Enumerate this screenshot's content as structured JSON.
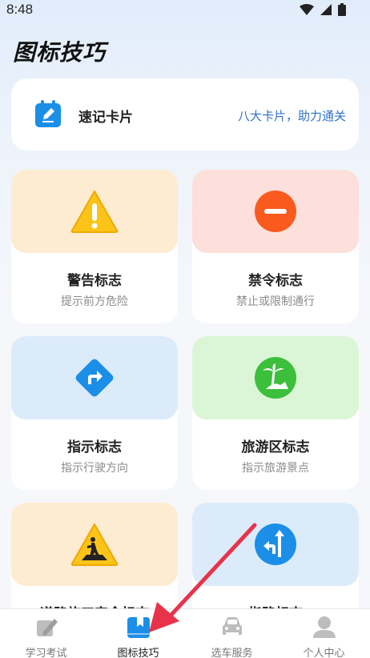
{
  "status": {
    "time": "8:48"
  },
  "header": {
    "title": "图标技巧"
  },
  "quick_card": {
    "title": "速记卡片",
    "link": "八大卡片，助力通关"
  },
  "tiles": [
    {
      "title": "警告标志",
      "sub": "提示前方危险",
      "icon": "warning-triangle-icon"
    },
    {
      "title": "禁令标志",
      "sub": "禁止或限制通行",
      "icon": "no-entry-icon"
    },
    {
      "title": "指示标志",
      "sub": "指示行驶方向",
      "icon": "turn-right-diamond-icon"
    },
    {
      "title": "旅游区标志",
      "sub": "指示旅游景点",
      "icon": "palm-tree-icon"
    },
    {
      "title": "道路施工安全标志",
      "icon": "road-work-icon"
    },
    {
      "title": "指路标志",
      "icon": "direction-arrows-icon"
    }
  ],
  "nav": [
    {
      "label": "学习考试",
      "icon": "pen-book-icon"
    },
    {
      "label": "图标技巧",
      "icon": "bookmark-book-icon",
      "active": true
    },
    {
      "label": "选车服务",
      "icon": "car-icon"
    },
    {
      "label": "个人中心",
      "icon": "user-icon"
    }
  ],
  "colors": {
    "warning_bg": "#fdecd1",
    "prohibit_bg": "#fde0db",
    "guide_bg": "#dcebfa",
    "tourism_bg": "#dbf6d6",
    "accent": "#1b8fe8",
    "arrow": "#e8334b"
  }
}
